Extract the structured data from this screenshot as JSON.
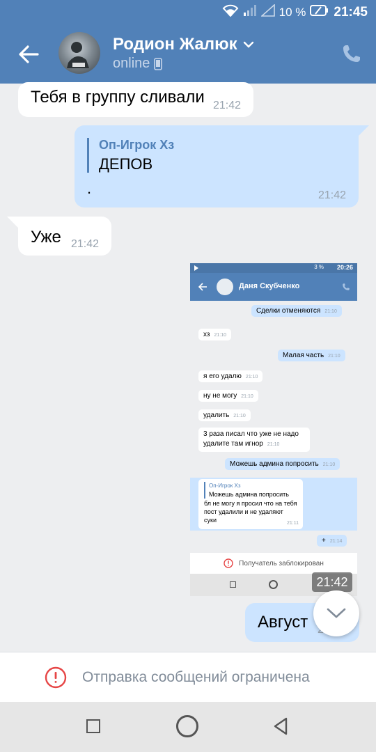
{
  "status_bar": {
    "battery": "10 %",
    "time": "21:45"
  },
  "header": {
    "title": "Родион Жалюк",
    "subtitle": "online"
  },
  "messages": [
    {
      "text": "Тебя в группу сливали",
      "time": "21:42"
    },
    {
      "reply_author": "Оп-Игрок Хз",
      "reply_text": "ДЕПОВ",
      "text": ".",
      "time": "21:42"
    },
    {
      "text": "Уже",
      "time": "21:42"
    },
    {
      "text": "Август",
      "time": "21:42"
    }
  ],
  "attached_screenshot": {
    "status_time": "20:26",
    "status_battery": "3 %",
    "contact_name": "Даня Скубченко",
    "messages": [
      {
        "text": "Сделки отменяются",
        "time": "21:10"
      },
      {
        "text": "хз",
        "time": "21:10"
      },
      {
        "text": "Малая часть",
        "time": "21:10"
      },
      {
        "text": "я его удалю",
        "time": "21:10"
      },
      {
        "text": "ну не могу",
        "time": "21:10"
      },
      {
        "text": "удалить",
        "time": "21:10"
      },
      {
        "text": "3 раза писал что уже не надо удалите там игнор",
        "time": "21:10"
      },
      {
        "text": "Можешь админа попросить",
        "time": "21:10"
      },
      {
        "reply_author": "Оп-Игрок Хз",
        "reply_text": "Можешь админа попросить",
        "text": "бл не могу я просил что на тебя пост удалили и не удаляют суки",
        "time": "21:11"
      },
      {
        "text": "+",
        "time": "21:14"
      }
    ],
    "blocked_text": "Получатель заблокирован"
  },
  "floating_time": "21:42",
  "restriction": {
    "text": "Отправка сообщений ограничена"
  },
  "colors": {
    "header": "#5181b8",
    "outgoing": "#cce4ff",
    "incoming": "#ffffff",
    "background": "#edeef0",
    "warning": "#e64646"
  }
}
